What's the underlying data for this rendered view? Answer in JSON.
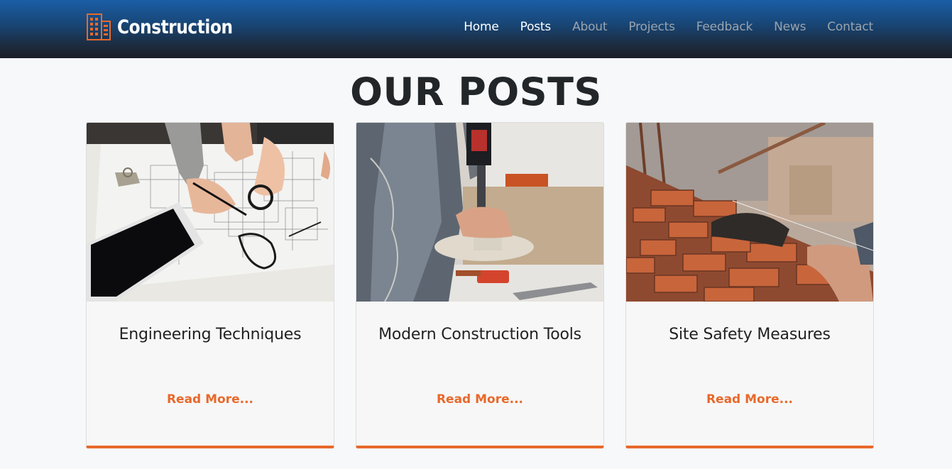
{
  "navbar": {
    "brand": "Construction",
    "links": [
      {
        "label": "Home",
        "active": true
      },
      {
        "label": "Posts",
        "active": true
      },
      {
        "label": "About",
        "active": false
      },
      {
        "label": "Projects",
        "active": false
      },
      {
        "label": "Feedback",
        "active": false
      },
      {
        "label": "News",
        "active": false
      },
      {
        "label": "Contact",
        "active": false
      }
    ]
  },
  "page_title": "OUR POSTS",
  "posts": [
    {
      "title": "Engineering Techniques",
      "link": "Read More...",
      "image": "blueprint-photo"
    },
    {
      "title": "Modern Construction Tools",
      "link": "Read More...",
      "image": "drill-photo"
    },
    {
      "title": "Site Safety Measures",
      "link": "Read More...",
      "image": "brick-wall-photo"
    }
  ],
  "colors": {
    "accent": "#e8692b",
    "nav_active": "#ffffff",
    "nav_inactive": "#9aa3ad",
    "title": "#222629"
  }
}
